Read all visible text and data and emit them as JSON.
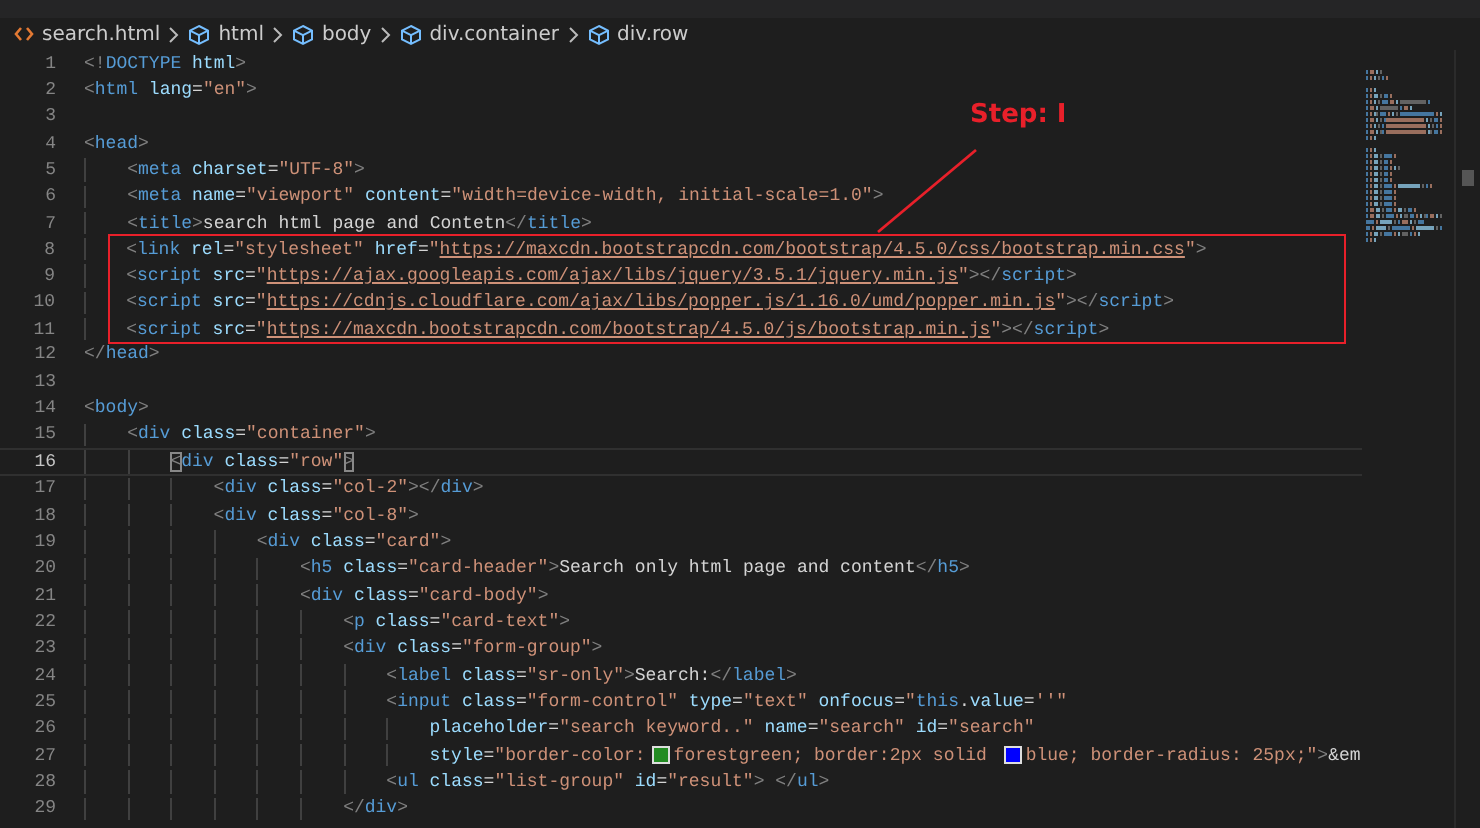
{
  "breadcrumb": [
    {
      "kind": "file",
      "label": "search.html"
    },
    {
      "kind": "element",
      "label": "html"
    },
    {
      "kind": "element",
      "label": "body"
    },
    {
      "kind": "element",
      "label": "div.container"
    },
    {
      "kind": "element",
      "label": "div.row"
    }
  ],
  "lines": [
    {
      "kind": "line",
      "number": "1",
      "current": false,
      "tokens": [
        {
          "kind": "punct",
          "text": "<!"
        },
        {
          "kind": "tag",
          "text": "DOCTYPE"
        },
        {
          "kind": "attr",
          "text": " html"
        },
        {
          "kind": "punct",
          "text": ">"
        }
      ]
    },
    {
      "kind": "line",
      "number": "2",
      "current": false,
      "tokens": [
        {
          "kind": "punct",
          "text": "<"
        },
        {
          "kind": "tag",
          "text": "html"
        },
        {
          "kind": "attr",
          "text": " lang"
        },
        {
          "kind": "text",
          "text": "="
        },
        {
          "kind": "str",
          "text": "\"en\""
        },
        {
          "kind": "punct",
          "text": ">"
        }
      ]
    },
    {
      "kind": "line",
      "number": "3",
      "current": false
    },
    {
      "kind": "line",
      "number": "4",
      "current": false,
      "tokens": [
        {
          "kind": "punct",
          "text": "<"
        },
        {
          "kind": "tag",
          "text": "head"
        },
        {
          "kind": "punct",
          "text": ">"
        }
      ]
    },
    {
      "kind": "line",
      "number": "5",
      "current": false,
      "tokens": [
        {
          "kind": "punct",
          "text": "    <"
        },
        {
          "kind": "tag",
          "text": "meta"
        },
        {
          "kind": "attr",
          "text": " charset"
        },
        {
          "kind": "text",
          "text": "="
        },
        {
          "kind": "str",
          "text": "\"UTF-8\""
        },
        {
          "kind": "punct",
          "text": ">"
        }
      ]
    },
    {
      "kind": "line",
      "number": "6",
      "current": false,
      "tokens": [
        {
          "kind": "punct",
          "text": "    <"
        },
        {
          "kind": "tag",
          "text": "meta"
        },
        {
          "kind": "attr",
          "text": " name"
        },
        {
          "kind": "text",
          "text": "="
        },
        {
          "kind": "str",
          "text": "\"viewport\""
        },
        {
          "kind": "attr",
          "text": " content"
        },
        {
          "kind": "text",
          "text": "="
        },
        {
          "kind": "str",
          "text": "\"width=device-width, initial-scale=1.0\""
        },
        {
          "kind": "punct",
          "text": ">"
        }
      ]
    },
    {
      "kind": "line",
      "number": "7",
      "current": false,
      "tokens": [
        {
          "kind": "punct",
          "text": "    <"
        },
        {
          "kind": "tag",
          "text": "title"
        },
        {
          "kind": "punct",
          "text": ">"
        },
        {
          "kind": "text",
          "text": "search html page and Contetn"
        },
        {
          "kind": "punct",
          "text": "</"
        },
        {
          "kind": "tag",
          "text": "title"
        },
        {
          "kind": "punct",
          "text": ">"
        }
      ]
    },
    {
      "kind": "annotation_box",
      "lines": [
        {
          "kind": "line",
          "number": "8",
          "current": false,
          "tokens": [
            {
              "kind": "punct",
              "text": "    <"
            },
            {
              "kind": "tag",
              "text": "link"
            },
            {
              "kind": "attr",
              "text": " rel"
            },
            {
              "kind": "text",
              "text": "="
            },
            {
              "kind": "str",
              "text": "\"stylesheet\""
            },
            {
              "kind": "attr",
              "text": " href"
            },
            {
              "kind": "text",
              "text": "="
            },
            {
              "kind": "str",
              "text": "\""
            },
            {
              "kind": "url",
              "text": "https://maxcdn.bootstrapcdn.com/bootstrap/4.5.0/css/bootstrap.min.css"
            },
            {
              "kind": "str",
              "text": "\""
            },
            {
              "kind": "punct",
              "text": ">"
            }
          ]
        },
        {
          "kind": "line",
          "number": "9",
          "current": false,
          "tokens": [
            {
              "kind": "punct",
              "text": "    <"
            },
            {
              "kind": "tag",
              "text": "script"
            },
            {
              "kind": "attr",
              "text": " src"
            },
            {
              "kind": "text",
              "text": "="
            },
            {
              "kind": "str",
              "text": "\""
            },
            {
              "kind": "url",
              "text": "https://ajax.googleapis.com/ajax/libs/jquery/3.5.1/jquery.min.js"
            },
            {
              "kind": "str",
              "text": "\""
            },
            {
              "kind": "punct",
              "text": "></"
            },
            {
              "kind": "tag",
              "text": "script"
            },
            {
              "kind": "punct",
              "text": ">"
            }
          ]
        },
        {
          "kind": "line",
          "number": "10",
          "current": false,
          "tokens": [
            {
              "kind": "punct",
              "text": "    <"
            },
            {
              "kind": "tag",
              "text": "script"
            },
            {
              "kind": "attr",
              "text": " src"
            },
            {
              "kind": "text",
              "text": "="
            },
            {
              "kind": "str",
              "text": "\""
            },
            {
              "kind": "url",
              "text": "https://cdnjs.cloudflare.com/ajax/libs/popper.js/1.16.0/umd/popper.min.js"
            },
            {
              "kind": "str",
              "text": "\""
            },
            {
              "kind": "punct",
              "text": "></"
            },
            {
              "kind": "tag",
              "text": "script"
            },
            {
              "kind": "punct",
              "text": ">"
            }
          ]
        },
        {
          "kind": "line",
          "number": "11",
          "current": false,
          "tokens": [
            {
              "kind": "punct",
              "text": "    <"
            },
            {
              "kind": "tag",
              "text": "script"
            },
            {
              "kind": "attr",
              "text": " src"
            },
            {
              "kind": "text",
              "text": "="
            },
            {
              "kind": "str",
              "text": "\""
            },
            {
              "kind": "url",
              "text": "https://maxcdn.bootstrapcdn.com/bootstrap/4.5.0/js/bootstrap.min.js"
            },
            {
              "kind": "str",
              "text": "\""
            },
            {
              "kind": "punct",
              "text": "></"
            },
            {
              "kind": "tag",
              "text": "script"
            },
            {
              "kind": "punct",
              "text": ">"
            }
          ]
        }
      ]
    },
    {
      "kind": "line",
      "number": "12",
      "current": false,
      "tokens": [
        {
          "kind": "punct",
          "text": "</"
        },
        {
          "kind": "tag",
          "text": "head"
        },
        {
          "kind": "punct",
          "text": ">"
        }
      ]
    },
    {
      "kind": "line",
      "number": "13",
      "current": false
    },
    {
      "kind": "line",
      "number": "14",
      "current": false,
      "tokens": [
        {
          "kind": "punct",
          "text": "<"
        },
        {
          "kind": "tag",
          "text": "body"
        },
        {
          "kind": "punct",
          "text": ">"
        }
      ]
    },
    {
      "kind": "line",
      "number": "15",
      "current": false,
      "tokens": [
        {
          "kind": "punct",
          "text": "    <"
        },
        {
          "kind": "tag",
          "text": "div"
        },
        {
          "kind": "attr",
          "text": " class"
        },
        {
          "kind": "text",
          "text": "="
        },
        {
          "kind": "str",
          "text": "\"container\""
        },
        {
          "kind": "punct",
          "text": ">"
        }
      ]
    },
    {
      "kind": "line",
      "number": "16",
      "current": true,
      "tokens": [
        {
          "kind": "bracket",
          "text": "        <"
        },
        {
          "kind": "tag",
          "text": "div"
        },
        {
          "kind": "attr",
          "text": " class"
        },
        {
          "kind": "text",
          "text": "="
        },
        {
          "kind": "str",
          "text": "\"row\""
        },
        {
          "kind": "bracket",
          "text": ">"
        }
      ]
    },
    {
      "kind": "line",
      "number": "17",
      "current": false,
      "tokens": [
        {
          "kind": "punct",
          "text": "            <"
        },
        {
          "kind": "tag",
          "text": "div"
        },
        {
          "kind": "attr",
          "text": " class"
        },
        {
          "kind": "text",
          "text": "="
        },
        {
          "kind": "str",
          "text": "\"col-2\""
        },
        {
          "kind": "punct",
          "text": "></"
        },
        {
          "kind": "tag",
          "text": "div"
        },
        {
          "kind": "punct",
          "text": ">"
        }
      ]
    },
    {
      "kind": "line",
      "number": "18",
      "current": false,
      "tokens": [
        {
          "kind": "punct",
          "text": "            <"
        },
        {
          "kind": "tag",
          "text": "div"
        },
        {
          "kind": "attr",
          "text": " class"
        },
        {
          "kind": "text",
          "text": "="
        },
        {
          "kind": "str",
          "text": "\"col-8\""
        },
        {
          "kind": "punct",
          "text": ">"
        }
      ]
    },
    {
      "kind": "line",
      "number": "19",
      "current": false,
      "tokens": [
        {
          "kind": "punct",
          "text": "                <"
        },
        {
          "kind": "tag",
          "text": "div"
        },
        {
          "kind": "attr",
          "text": " class"
        },
        {
          "kind": "text",
          "text": "="
        },
        {
          "kind": "str",
          "text": "\"card\""
        },
        {
          "kind": "punct",
          "text": ">"
        }
      ]
    },
    {
      "kind": "line",
      "number": "20",
      "current": false,
      "tokens": [
        {
          "kind": "punct",
          "text": "                    <"
        },
        {
          "kind": "tag",
          "text": "h5"
        },
        {
          "kind": "attr",
          "text": " class"
        },
        {
          "kind": "text",
          "text": "="
        },
        {
          "kind": "str",
          "text": "\"card-header\""
        },
        {
          "kind": "punct",
          "text": ">"
        },
        {
          "kind": "text",
          "text": "Search only html page and content"
        },
        {
          "kind": "punct",
          "text": "</"
        },
        {
          "kind": "tag",
          "text": "h5"
        },
        {
          "kind": "punct",
          "text": ">"
        }
      ]
    },
    {
      "kind": "line",
      "number": "21",
      "current": false,
      "tokens": [
        {
          "kind": "punct",
          "text": "                    <"
        },
        {
          "kind": "tag",
          "text": "div"
        },
        {
          "kind": "attr",
          "text": " class"
        },
        {
          "kind": "text",
          "text": "="
        },
        {
          "kind": "str",
          "text": "\"card-body\""
        },
        {
          "kind": "punct",
          "text": ">"
        }
      ]
    },
    {
      "kind": "line",
      "number": "22",
      "current": false,
      "tokens": [
        {
          "kind": "punct",
          "text": "                        <"
        },
        {
          "kind": "tag",
          "text": "p"
        },
        {
          "kind": "attr",
          "text": " class"
        },
        {
          "kind": "text",
          "text": "="
        },
        {
          "kind": "str",
          "text": "\"card-text\""
        },
        {
          "kind": "punct",
          "text": ">"
        }
      ]
    },
    {
      "kind": "line",
      "number": "23",
      "current": false,
      "tokens": [
        {
          "kind": "punct",
          "text": "                        <"
        },
        {
          "kind": "tag",
          "text": "div"
        },
        {
          "kind": "attr",
          "text": " class"
        },
        {
          "kind": "text",
          "text": "="
        },
        {
          "kind": "str",
          "text": "\"form-group\""
        },
        {
          "kind": "punct",
          "text": ">"
        }
      ]
    },
    {
      "kind": "line",
      "number": "24",
      "current": false,
      "tokens": [
        {
          "kind": "punct",
          "text": "                            <"
        },
        {
          "kind": "tag",
          "text": "label"
        },
        {
          "kind": "attr",
          "text": " class"
        },
        {
          "kind": "text",
          "text": "="
        },
        {
          "kind": "str",
          "text": "\"sr-only\""
        },
        {
          "kind": "punct",
          "text": ">"
        },
        {
          "kind": "text",
          "text": "Search:"
        },
        {
          "kind": "punct",
          "text": "</"
        },
        {
          "kind": "tag",
          "text": "label"
        },
        {
          "kind": "punct",
          "text": ">"
        }
      ]
    },
    {
      "kind": "line",
      "number": "25",
      "current": false,
      "tokens": [
        {
          "kind": "punct",
          "text": "                            <"
        },
        {
          "kind": "tag",
          "text": "input"
        },
        {
          "kind": "attr",
          "text": " class"
        },
        {
          "kind": "text",
          "text": "="
        },
        {
          "kind": "str",
          "text": "\"form-control\""
        },
        {
          "kind": "attr",
          "text": " type"
        },
        {
          "kind": "text",
          "text": "="
        },
        {
          "kind": "str",
          "text": "\"text\""
        },
        {
          "kind": "attr",
          "text": " onfocus"
        },
        {
          "kind": "text",
          "text": "="
        },
        {
          "kind": "str",
          "text": "\""
        },
        {
          "kind": "tag",
          "text": "this"
        },
        {
          "kind": "text",
          "text": "."
        },
        {
          "kind": "attr",
          "text": "value"
        },
        {
          "kind": "text",
          "text": "="
        },
        {
          "kind": "str",
          "text": "''\""
        }
      ]
    },
    {
      "kind": "line",
      "number": "26",
      "current": false,
      "tokens": [
        {
          "kind": "attr",
          "text": "                                placeholder"
        },
        {
          "kind": "text",
          "text": "="
        },
        {
          "kind": "str",
          "text": "\"search keyword..\""
        },
        {
          "kind": "attr",
          "text": " name"
        },
        {
          "kind": "text",
          "text": "="
        },
        {
          "kind": "str",
          "text": "\"search\""
        },
        {
          "kind": "attr",
          "text": " id"
        },
        {
          "kind": "text",
          "text": "="
        },
        {
          "kind": "str",
          "text": "\"search\""
        }
      ]
    },
    {
      "kind": "line",
      "number": "27",
      "current": false,
      "tokens": [
        {
          "kind": "attr",
          "text": "                                style"
        },
        {
          "kind": "text",
          "text": "="
        },
        {
          "kind": "str",
          "text": "\"border-color:"
        },
        {
          "kind": "swatch",
          "color": "#228b22"
        },
        {
          "kind": "str",
          "text": "forestgreen; border:2px solid "
        },
        {
          "kind": "swatch",
          "color": "#0000ff"
        },
        {
          "kind": "str",
          "text": "blue; border-radius: 25px;\""
        },
        {
          "kind": "punct",
          "text": ">"
        },
        {
          "kind": "text",
          "text": "&em"
        }
      ]
    },
    {
      "kind": "line",
      "number": "28",
      "current": false,
      "tokens": [
        {
          "kind": "punct",
          "text": "                            <"
        },
        {
          "kind": "tag",
          "text": "ul"
        },
        {
          "kind": "attr",
          "text": " class"
        },
        {
          "kind": "text",
          "text": "="
        },
        {
          "kind": "str",
          "text": "\"list-group\""
        },
        {
          "kind": "attr",
          "text": " id"
        },
        {
          "kind": "text",
          "text": "="
        },
        {
          "kind": "str",
          "text": "\"result\""
        },
        {
          "kind": "punct",
          "text": "> </"
        },
        {
          "kind": "tag",
          "text": "ul"
        },
        {
          "kind": "punct",
          "text": ">"
        }
      ]
    },
    {
      "kind": "line",
      "number": "29",
      "current": false,
      "tokens": [
        {
          "kind": "punct",
          "text": "                        </"
        },
        {
          "kind": "tag",
          "text": "div"
        },
        {
          "kind": "punct",
          "text": ">"
        }
      ]
    }
  ],
  "annotation": {
    "label": "Step: I"
  }
}
